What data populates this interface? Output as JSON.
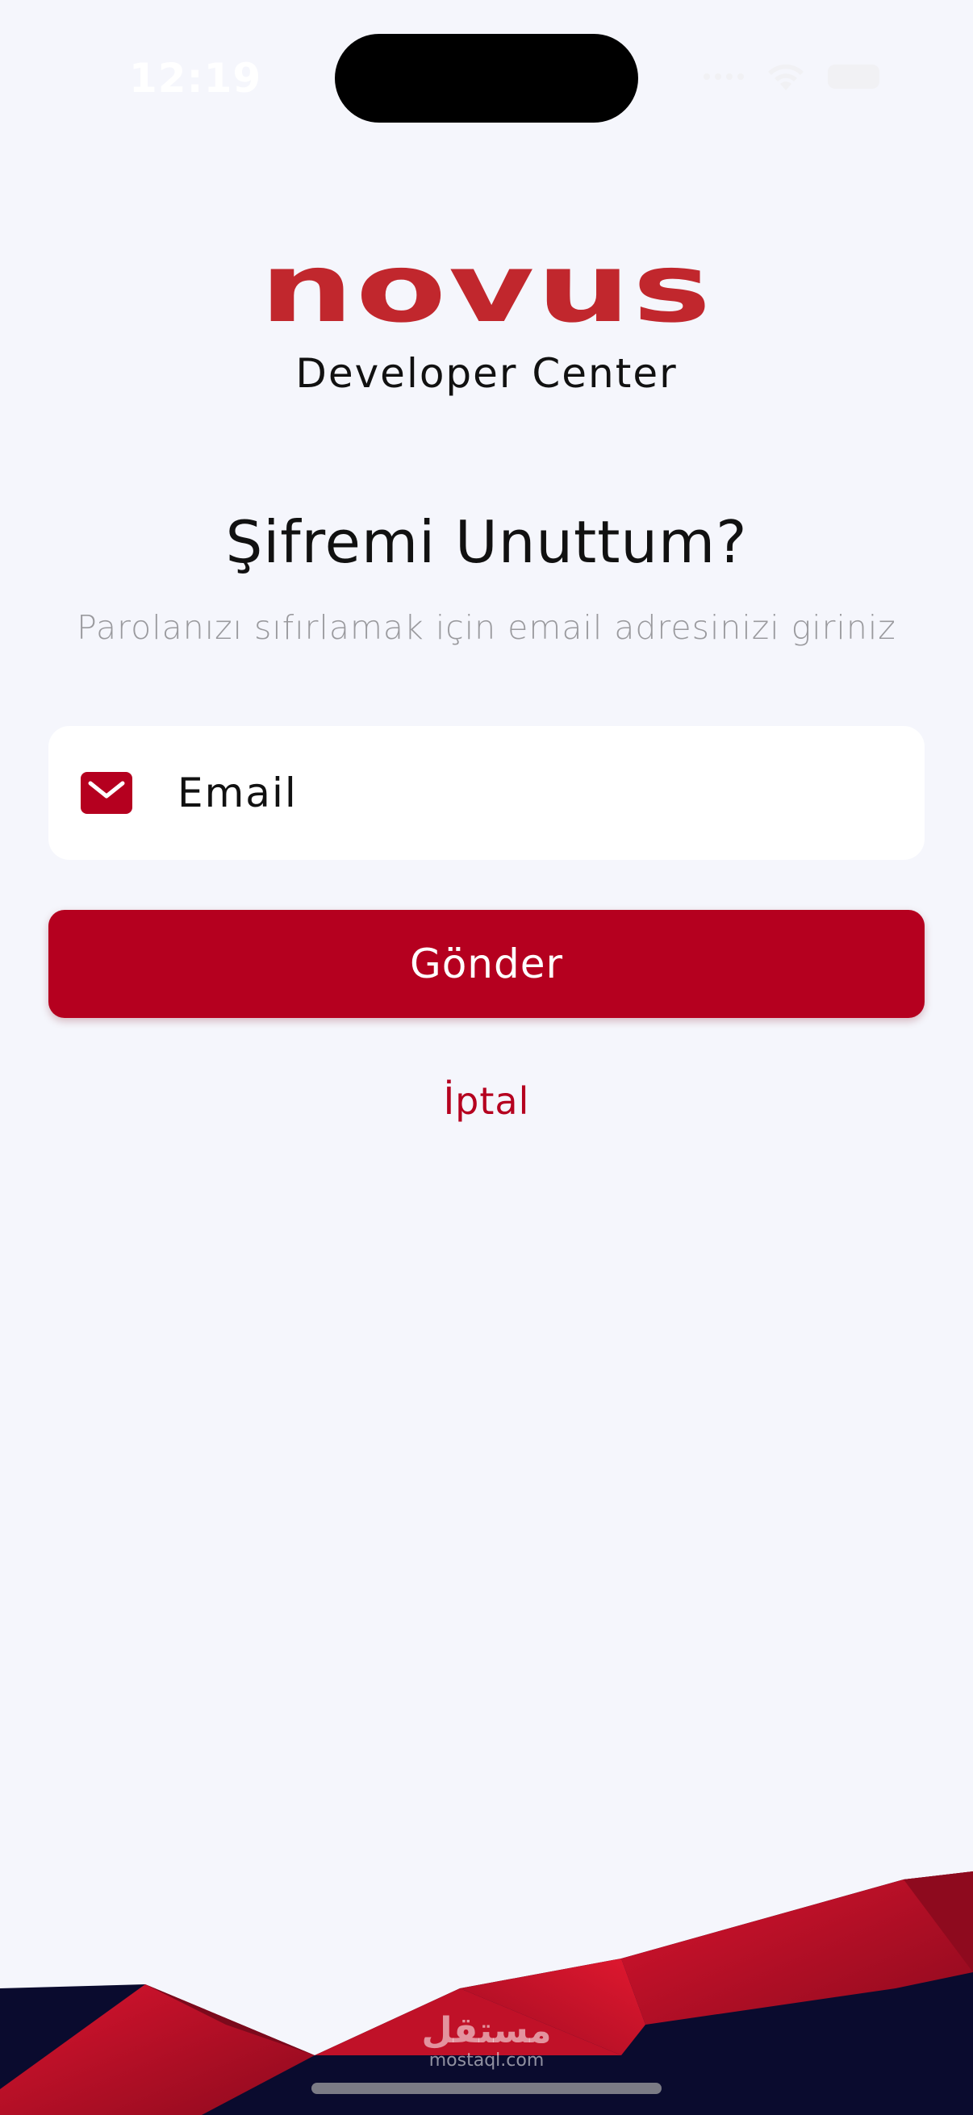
{
  "status_bar": {
    "time": "12:19"
  },
  "brand": {
    "logo_text": "novus",
    "subtitle": "Developer Center",
    "color": "#c1272d"
  },
  "form": {
    "title": "Şifremi Unuttum?",
    "subtitle": "Parolanızı sıfırlamak için email adresinizi giriniz",
    "email_placeholder": "Email",
    "email_icon": "mail-icon",
    "submit_label": "Gönder",
    "cancel_label": "İptal"
  },
  "theme": {
    "accent": "#b5001f",
    "background": "#f5f6fc",
    "dark_navy": "#0a0b2e"
  },
  "watermark": {
    "arabic": "مستقل",
    "url": "mostaql.com"
  }
}
